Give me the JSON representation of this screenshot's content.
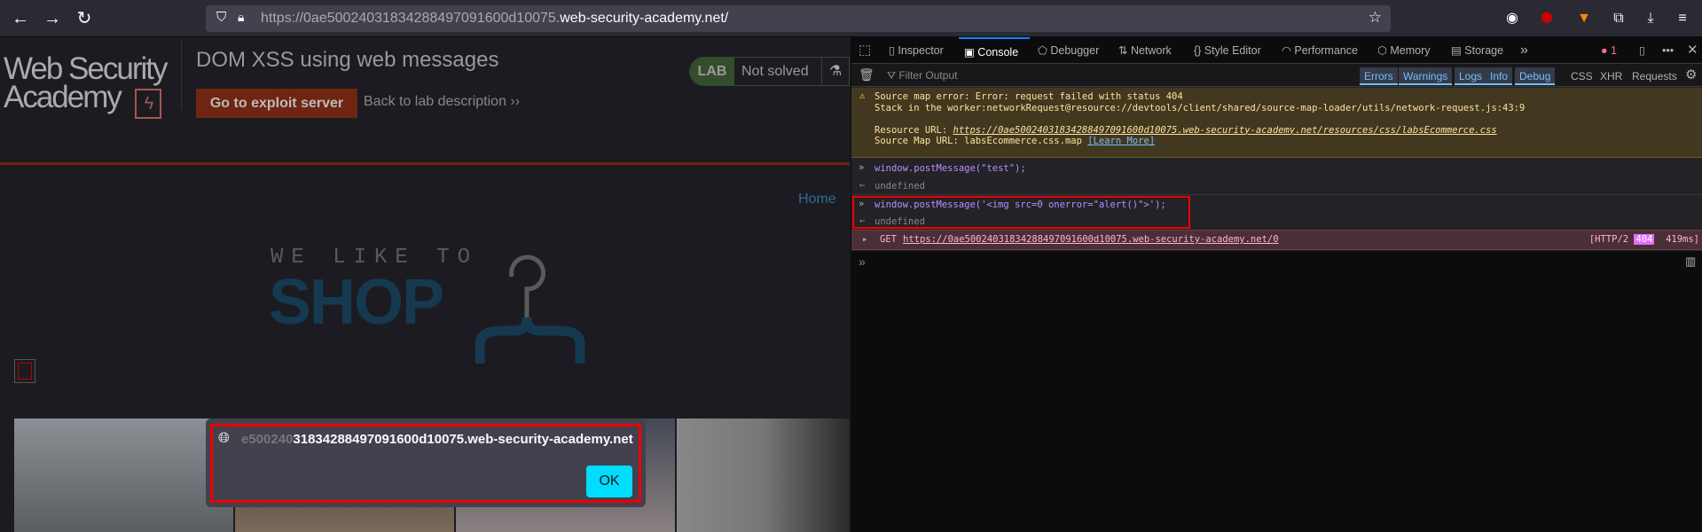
{
  "browser": {
    "url_prefix": "https://0ae500240318342884970916",
    "url_domain_prefix": "00d10075.",
    "url_domain": "web-security-academy.net/",
    "url_full": "https://0ae50024031834288497091600d10075.web-security-academy.net/"
  },
  "lab": {
    "logo_line1": "Web Security",
    "logo_line2": "Academy",
    "title": "DOM XSS using web messages",
    "exploit_button": "Go to exploit server",
    "back_link": "Back to lab description",
    "badge_label": "LAB",
    "status": "Not solved",
    "accent": "#6f2511"
  },
  "shop": {
    "home_link": "Home",
    "tagline": "WE LIKE TO",
    "brand": "SHOP",
    "brand_color": "#15394f"
  },
  "alert": {
    "origin_faded": "e500240",
    "origin": "31834288497091600d10075.web-security-academy.net",
    "ok": "OK",
    "ok_color": "#00ddff"
  },
  "devtools": {
    "tabs": [
      {
        "label": "Inspector",
        "icon": "inspector-icon"
      },
      {
        "label": "Console",
        "icon": "console-icon"
      },
      {
        "label": "Debugger",
        "icon": "debugger-icon"
      },
      {
        "label": "Network",
        "icon": "network-icon"
      },
      {
        "label": "Style Editor",
        "icon": "style-editor-icon"
      },
      {
        "label": "Performance",
        "icon": "performance-icon"
      },
      {
        "label": "Memory",
        "icon": "memory-icon"
      },
      {
        "label": "Storage",
        "icon": "storage-icon"
      }
    ],
    "error_count": "1",
    "filter_placeholder": "Filter Output",
    "filters": [
      "Errors",
      "Warnings",
      "Logs",
      "Info",
      "Debug"
    ],
    "extra_filters": [
      "CSS",
      "XHR",
      "Requests"
    ],
    "warning": {
      "line1": "Source map error: Error: request failed with status 404",
      "line2": "Stack in the worker:networkRequest@resource://devtools/client/shared/source-map-loader/utils/network-request.js:43:9",
      "resource_label": "Resource URL:",
      "resource_url": "https://0ae50024031834288497091600d10075.web-security-academy.net/resources/css/labsEcommerce.css",
      "map_label": "Source Map URL:",
      "map_file": "labsEcommerce.css.map",
      "learn_more": "[Learn More]"
    },
    "entries": [
      {
        "input": "window.postMessage(\"test\");",
        "result": "undefined"
      },
      {
        "input": "window.postMessage('<img src=0 onerror=\"alert()\">');",
        "result": "undefined"
      }
    ],
    "network": {
      "method": "GET",
      "url": "https://0ae50024031834288497091600d10075.web-security-academy.net/0",
      "proto": "[HTTP/2",
      "status": "404",
      "time": "419ms]"
    }
  }
}
